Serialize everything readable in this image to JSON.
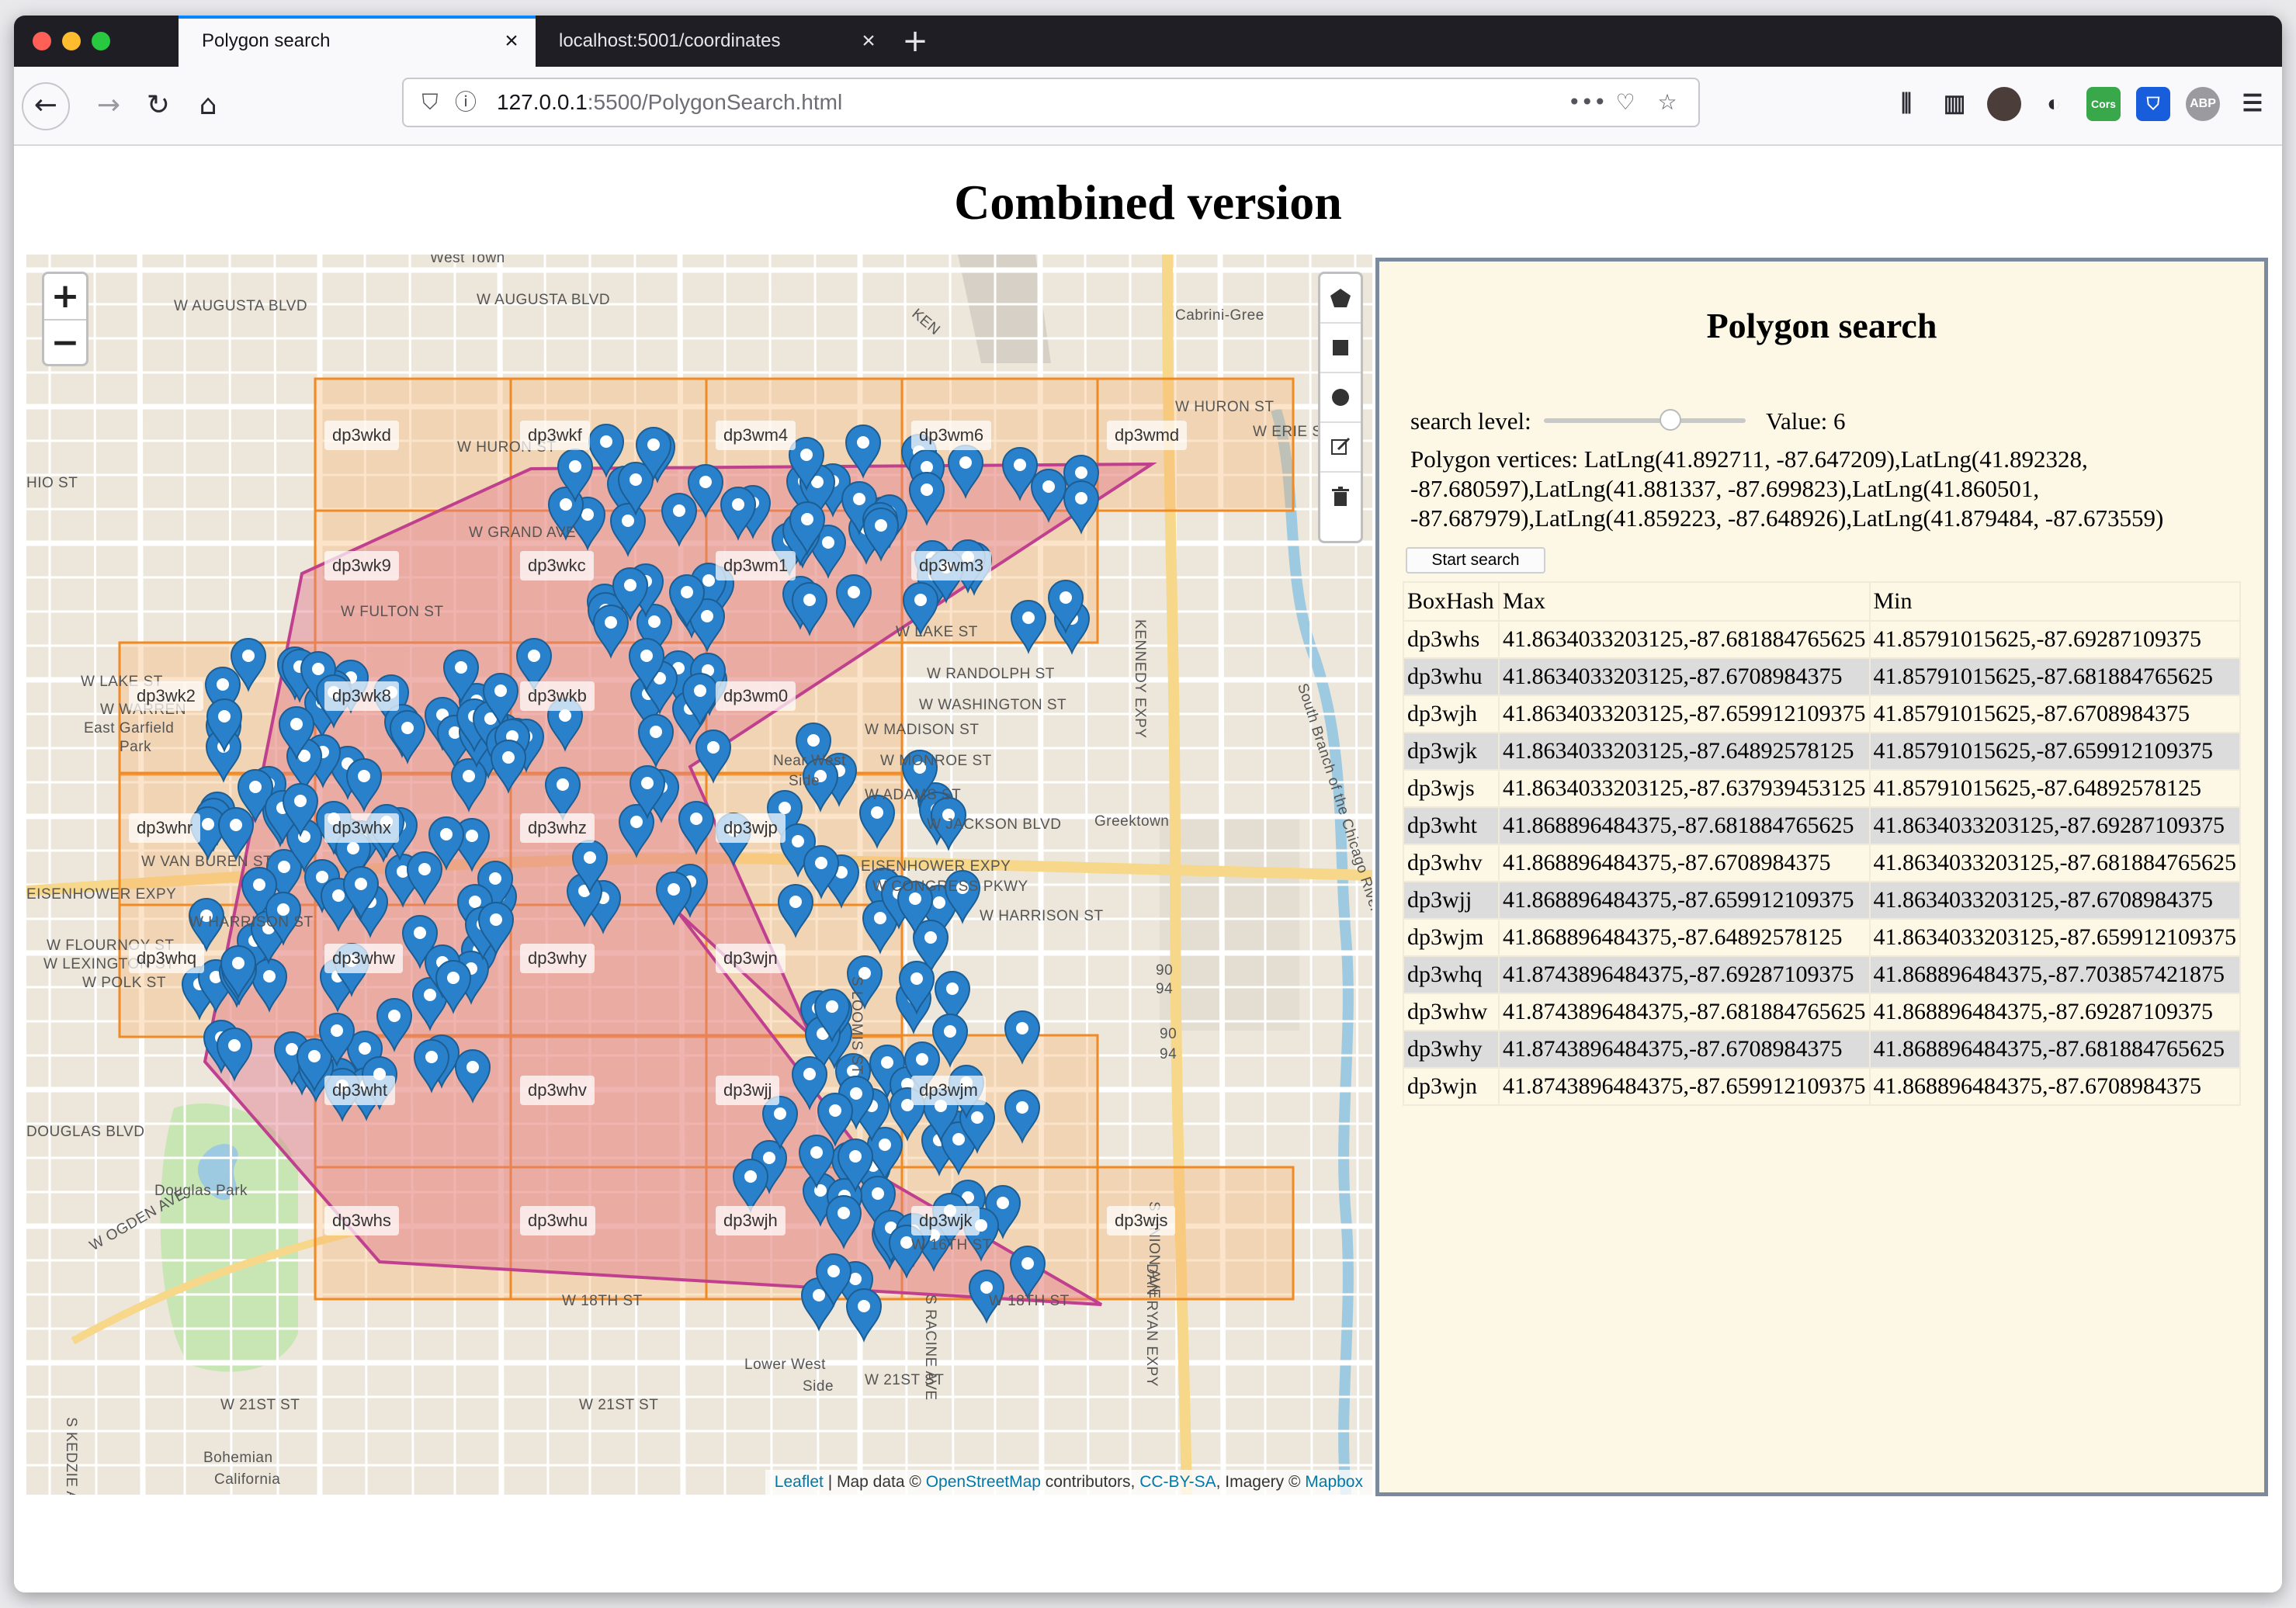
{
  "browser": {
    "tabs": [
      {
        "label": "Polygon search",
        "active": true
      },
      {
        "label": "localhost:5001/coordinates",
        "active": false
      }
    ],
    "url_host": "127.0.0.1",
    "url_path": ":5500/PolygonSearch.html"
  },
  "page": {
    "title": "Combined version"
  },
  "map": {
    "zoom_in": "+",
    "zoom_out": "−",
    "geohash_cells": [
      "dp3wkd",
      "dp3wkf",
      "dp3wm4",
      "dp3wm6",
      "dp3wmd",
      "dp3wk9",
      "dp3wkc",
      "dp3wm1",
      "dp3wm3",
      "dp3wk2",
      "dp3wk8",
      "dp3wkb",
      "dp3wm0",
      "dp3whr",
      "dp3whx",
      "dp3whz",
      "dp3wjp",
      "dp3whq",
      "dp3whw",
      "dp3why",
      "dp3wjn",
      "dp3wht",
      "dp3whv",
      "dp3wjj",
      "dp3wjm",
      "dp3whs",
      "dp3whu",
      "dp3wjh",
      "dp3wjk",
      "dp3wjs"
    ],
    "streets": [
      "West Town",
      "W AUGUSTA BLVD",
      "W AUGUSTA BLVD",
      "Cabrini-Gree",
      "W HURON ST",
      "W ERIE ST",
      "HIO ST",
      "W HURON ST",
      "W GRAND AVE",
      "W FULTON ST",
      "W LAKE ST",
      "W LAKE ST",
      "W RANDOLPH ST",
      "W WASHINGTON ST",
      "W WARREN",
      "East Garfield",
      "Park",
      "W MADISON ST",
      "Near West",
      "Side",
      "W MONROE ST",
      "W ADAMS ST",
      "Greektown",
      "W JACKSON BLVD",
      "W VAN BUREN ST",
      "EISENHOWER EXPY",
      "EISENHOWER EXPY",
      "W CONGRESS PKWY",
      "W HARRISON ST",
      "W HARRISON ST",
      "W FLOURNOY ST",
      "W LEXINGTON ST",
      "W POLK ST",
      "DOUGLAS BLVD",
      "Douglas Park",
      "W OGDEN AVE",
      "W 18TH ST",
      "W 18TH ST",
      "W 16TH ST",
      "W 21ST ST",
      "W 21ST ST",
      "W 21ST ST",
      "Lower West",
      "Side",
      "Bohemian",
      "California",
      "KENNEDY EXPY",
      "S UNION AVE",
      "DAN RYAN EXPY",
      "S RACINE AVE",
      "S LOOMIS ST",
      "S KEDZIE AVE",
      "South Branch of the Chicago River",
      "90",
      "94",
      "90",
      "94",
      "KEN"
    ],
    "attribution": {
      "leaflet": "Leaflet",
      "text1": " | Map data © ",
      "osm": "OpenStreetMap",
      "text2": " contributors, ",
      "license": "CC-BY-SA",
      "text3": ", Imagery © ",
      "mapbox": "Mapbox"
    }
  },
  "panel": {
    "title": "Polygon search",
    "search_level_label": "search level:",
    "search_level_value": 6,
    "search_level_min": 1,
    "search_level_max": 9,
    "value_text": "Value: 6",
    "vertices_text": "Polygon vertices: LatLng(41.892711, -87.647209),LatLng(41.892328, -87.680597),LatLng(41.881337, -87.699823),LatLng(41.860501, -87.687979),LatLng(41.859223, -87.648926),LatLng(41.879484, -87.673559)",
    "start_button": "Start search",
    "table": {
      "headers": [
        "BoxHash",
        "Max",
        "Min"
      ],
      "rows": [
        [
          "dp3whs",
          "41.8634033203125,-87.681884765625",
          "41.85791015625,-87.69287109375"
        ],
        [
          "dp3whu",
          "41.8634033203125,-87.6708984375",
          "41.85791015625,-87.681884765625"
        ],
        [
          "dp3wjh",
          "41.8634033203125,-87.659912109375",
          "41.85791015625,-87.6708984375"
        ],
        [
          "dp3wjk",
          "41.8634033203125,-87.64892578125",
          "41.85791015625,-87.659912109375"
        ],
        [
          "dp3wjs",
          "41.8634033203125,-87.637939453125",
          "41.85791015625,-87.64892578125"
        ],
        [
          "dp3wht",
          "41.868896484375,-87.681884765625",
          "41.8634033203125,-87.69287109375"
        ],
        [
          "dp3whv",
          "41.868896484375,-87.6708984375",
          "41.8634033203125,-87.681884765625"
        ],
        [
          "dp3wjj",
          "41.868896484375,-87.659912109375",
          "41.8634033203125,-87.6708984375"
        ],
        [
          "dp3wjm",
          "41.868896484375,-87.64892578125",
          "41.8634033203125,-87.659912109375"
        ],
        [
          "dp3whq",
          "41.8743896484375,-87.69287109375",
          "41.868896484375,-87.703857421875"
        ],
        [
          "dp3whw",
          "41.8743896484375,-87.681884765625",
          "41.868896484375,-87.69287109375"
        ],
        [
          "dp3why",
          "41.8743896484375,-87.6708984375",
          "41.868896484375,-87.681884765625"
        ],
        [
          "dp3wjn",
          "41.8743896484375,-87.659912109375",
          "41.868896484375,-87.6708984375"
        ]
      ]
    }
  },
  "colors": {
    "geohash_stroke": "#f08a24",
    "geohash_fill": "#f6b26b",
    "polygon_stroke": "#c0408f",
    "polygon_fill": "#e07a8f",
    "marker": "#2a81cb",
    "panel_bg": "#fdf7e5",
    "row_alt": "#dcdcdc"
  }
}
